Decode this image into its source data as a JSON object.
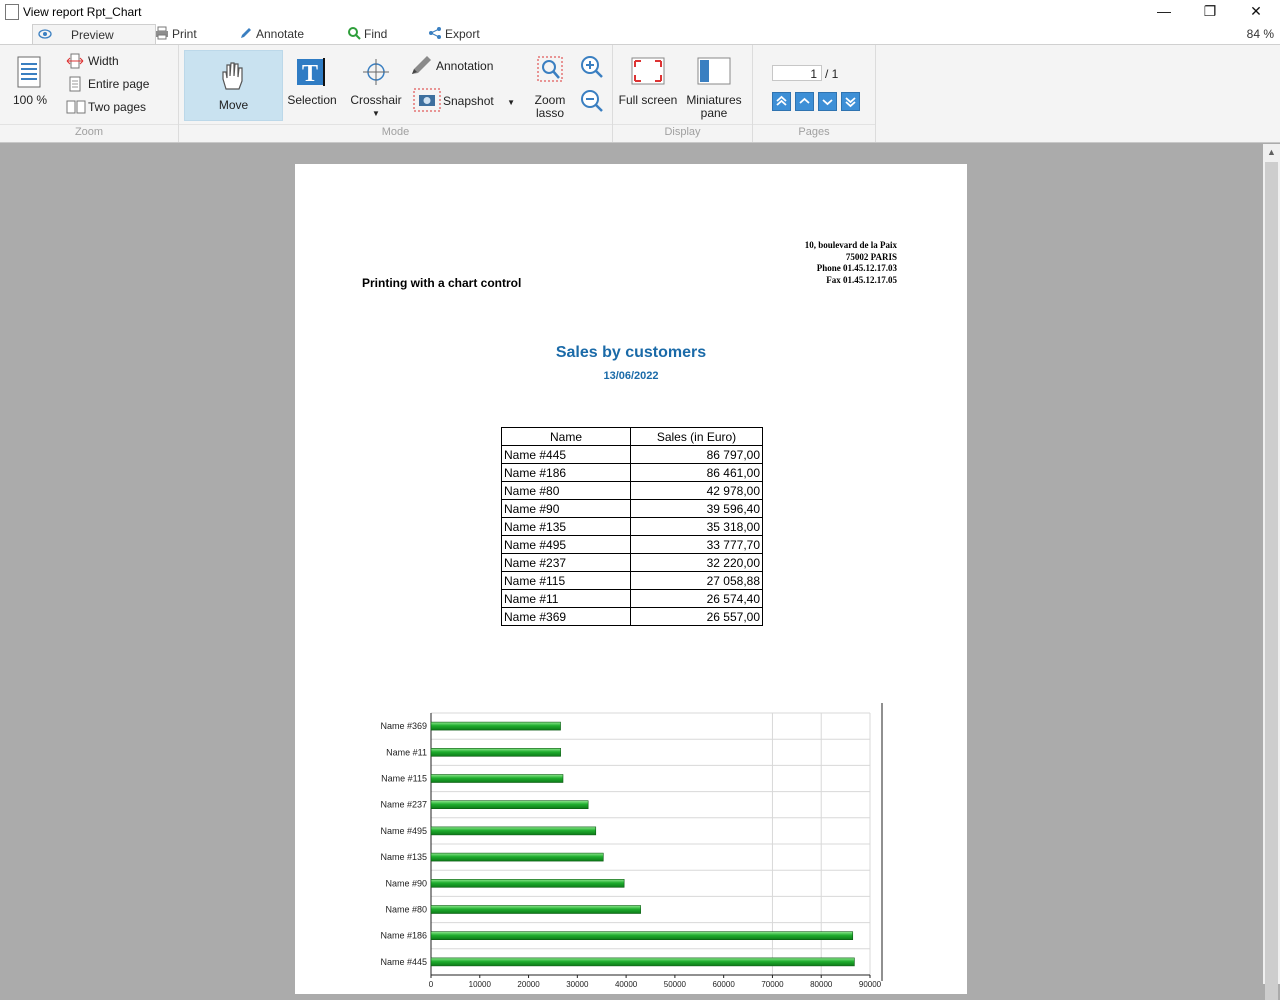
{
  "window": {
    "title": "View report Rpt_Chart",
    "minimize": "—",
    "restore": "❐",
    "close": "✕"
  },
  "tabs": [
    {
      "label": "Preview",
      "icon": "eye-icon"
    },
    {
      "label": "Print",
      "icon": "printer-icon"
    },
    {
      "label": "Annotate",
      "icon": "pencil-icon"
    },
    {
      "label": "Find",
      "icon": "magnifier-icon"
    },
    {
      "label": "Export",
      "icon": "share-icon"
    }
  ],
  "zoom_level": "84 %",
  "ribbon": {
    "zoom": {
      "group_label": "Zoom",
      "percent_label": "100 %",
      "width_label": "Width",
      "entire_page_label": "Entire page",
      "two_pages_label": "Two pages"
    },
    "mode": {
      "group_label": "Mode",
      "move_label": "Move",
      "selection_label": "Selection",
      "crosshair_label": "Crosshair",
      "annotation_label": "Annotation",
      "snapshot_label": "Snapshot",
      "zoom_lasso_label_1": "Zoom",
      "zoom_lasso_label_2": "lasso"
    },
    "display": {
      "group_label": "Display",
      "full_screen_label": "Full screen",
      "miniatures_label_1": "Miniatures",
      "miniatures_label_2": "pane"
    },
    "pages": {
      "group_label": "Pages",
      "current_page": "1",
      "total_pages": "/ 1"
    }
  },
  "report": {
    "address": [
      "10, boulevard de la Paix",
      "75002 PARIS",
      "Phone 01.45.12.17.03",
      "Fax 01.45.12.17.05"
    ],
    "subtitle": "Printing with a chart control",
    "title": "Sales by customers",
    "date": "13/06/2022",
    "table": {
      "headers": [
        "Name",
        "Sales (in Euro)"
      ],
      "rows": [
        [
          "Name #445",
          "86 797,00"
        ],
        [
          "Name #186",
          "86 461,00"
        ],
        [
          "Name #80",
          "42 978,00"
        ],
        [
          "Name #90",
          "39 596,40"
        ],
        [
          "Name #135",
          "35 318,00"
        ],
        [
          "Name #495",
          "33 777,70"
        ],
        [
          "Name #237",
          "32 220,00"
        ],
        [
          "Name #115",
          "27 058,88"
        ],
        [
          "Name #11",
          "26 574,40"
        ],
        [
          "Name #369",
          "26 557,00"
        ]
      ]
    }
  },
  "colors": {
    "bar": "#1fae2e",
    "accent": "#1a6aa8",
    "active_mode": "#c9e2f0"
  },
  "chart_data": {
    "type": "bar",
    "orientation": "horizontal",
    "categories": [
      "Name #369",
      "Name #11",
      "Name #115",
      "Name #237",
      "Name #495",
      "Name #135",
      "Name #90",
      "Name #80",
      "Name #186",
      "Name #445"
    ],
    "values": [
      26557,
      26574.4,
      27058.88,
      32220,
      33777.7,
      35318,
      39596.4,
      42978,
      86461,
      86797
    ],
    "xlim": [
      0,
      90000
    ],
    "xticks": [
      0,
      10000,
      20000,
      30000,
      40000,
      50000,
      60000,
      70000,
      80000,
      90000
    ],
    "grid": true
  }
}
